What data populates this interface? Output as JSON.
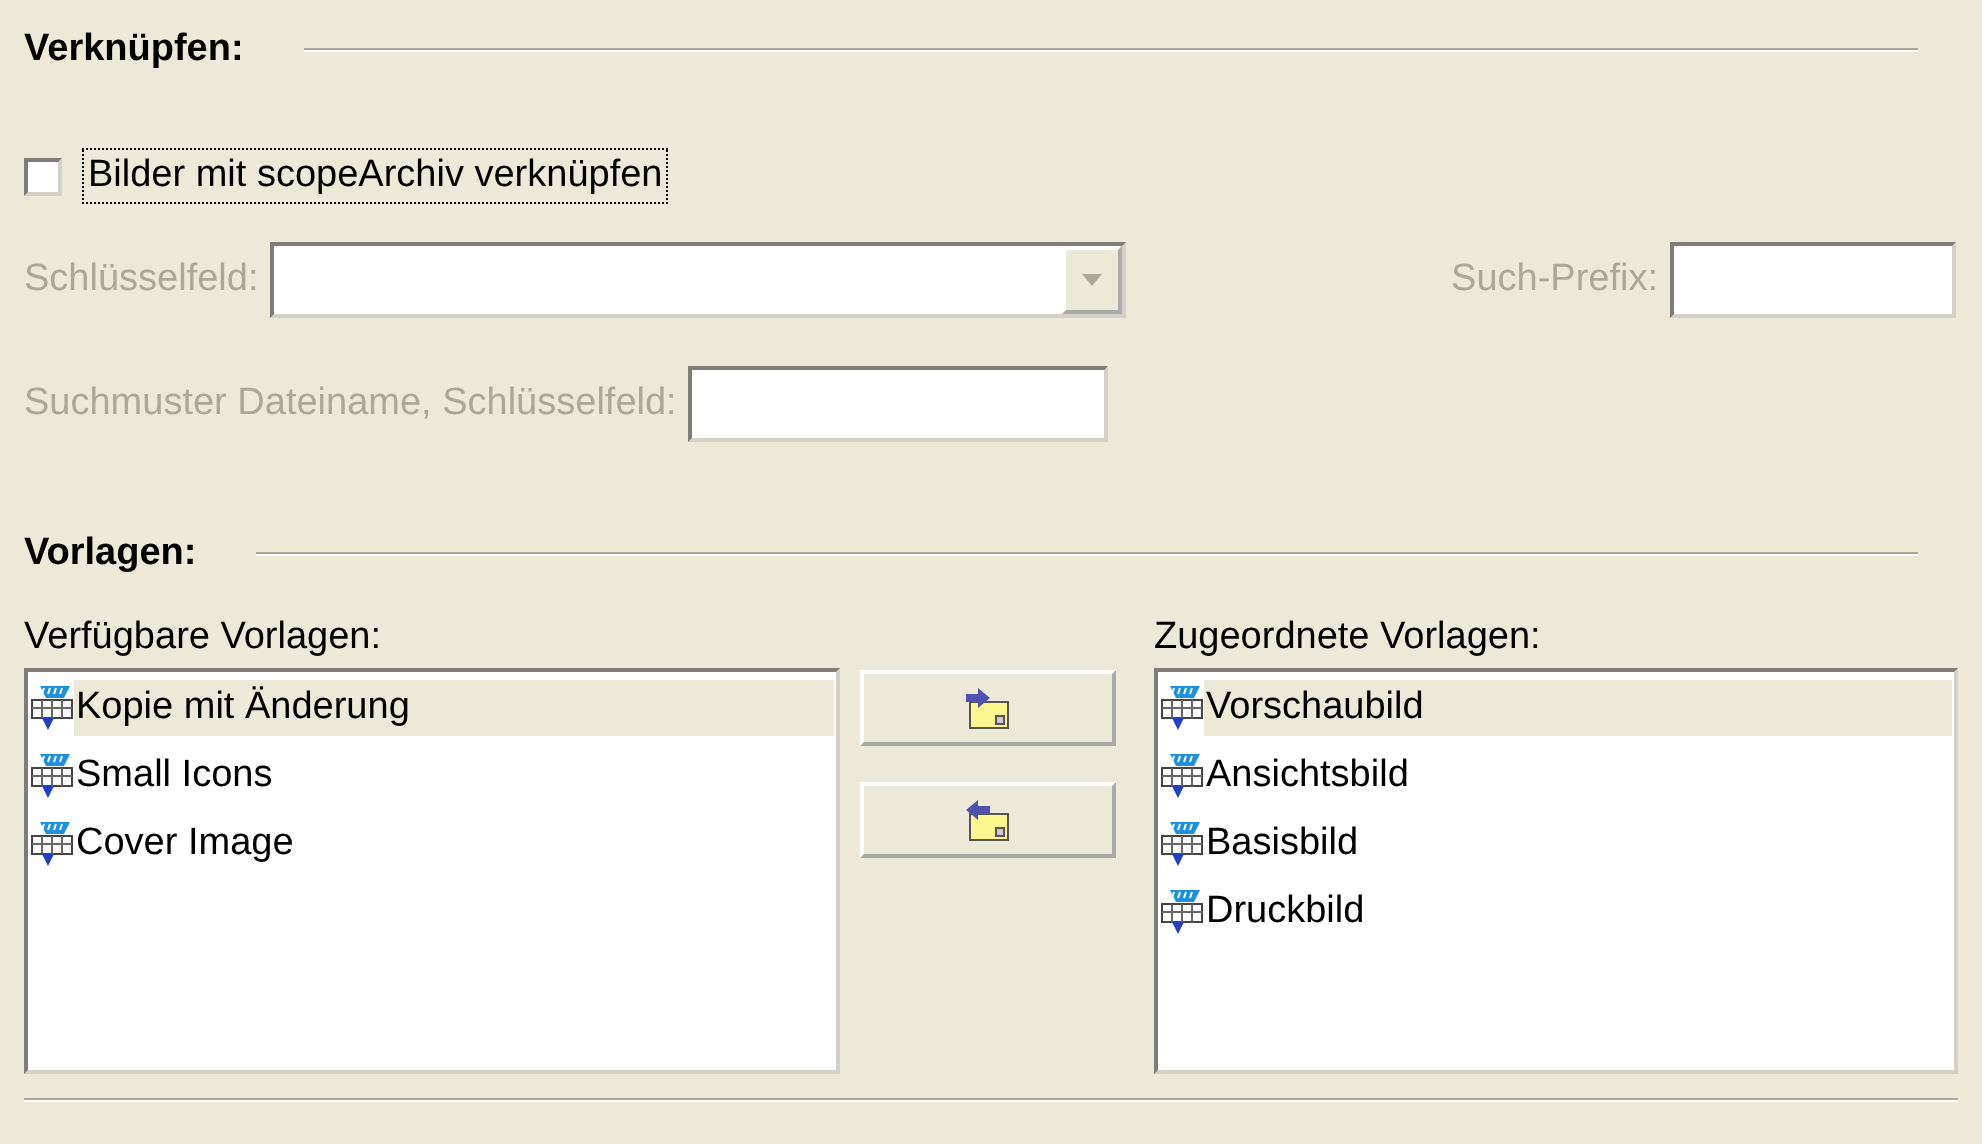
{
  "link_section": {
    "heading": "Verknüpfen:",
    "checkbox": {
      "label": "Bilder mit scopeArchiv verknüpfen",
      "checked": false,
      "focused": true
    },
    "key_field": {
      "label": "Schlüsselfeld:",
      "disabled": true
    },
    "search_prefix": {
      "label": "Such-Prefix:",
      "disabled": true
    },
    "search_pattern": {
      "label": "Suchmuster Dateiname, Schlüsselfeld:",
      "disabled": true
    }
  },
  "templates_section": {
    "heading": "Vorlagen:",
    "available": {
      "label": "Verfügbare Vorlagen:",
      "items": [
        {
          "label": "Kopie mit Änderung",
          "selected": true
        },
        {
          "label": "Small Icons",
          "selected": false
        },
        {
          "label": "Cover Image",
          "selected": false
        }
      ]
    },
    "buttons": [
      {
        "kind": "add"
      },
      {
        "kind": "remove"
      }
    ],
    "assigned": {
      "label": "Zugeordnete Vorlagen:",
      "items": [
        {
          "label": "Vorschaubild",
          "selected": true
        },
        {
          "label": "Ansichtsbild",
          "selected": false
        },
        {
          "label": "Basisbild",
          "selected": false
        },
        {
          "label": "Druckbild",
          "selected": false
        }
      ]
    }
  }
}
